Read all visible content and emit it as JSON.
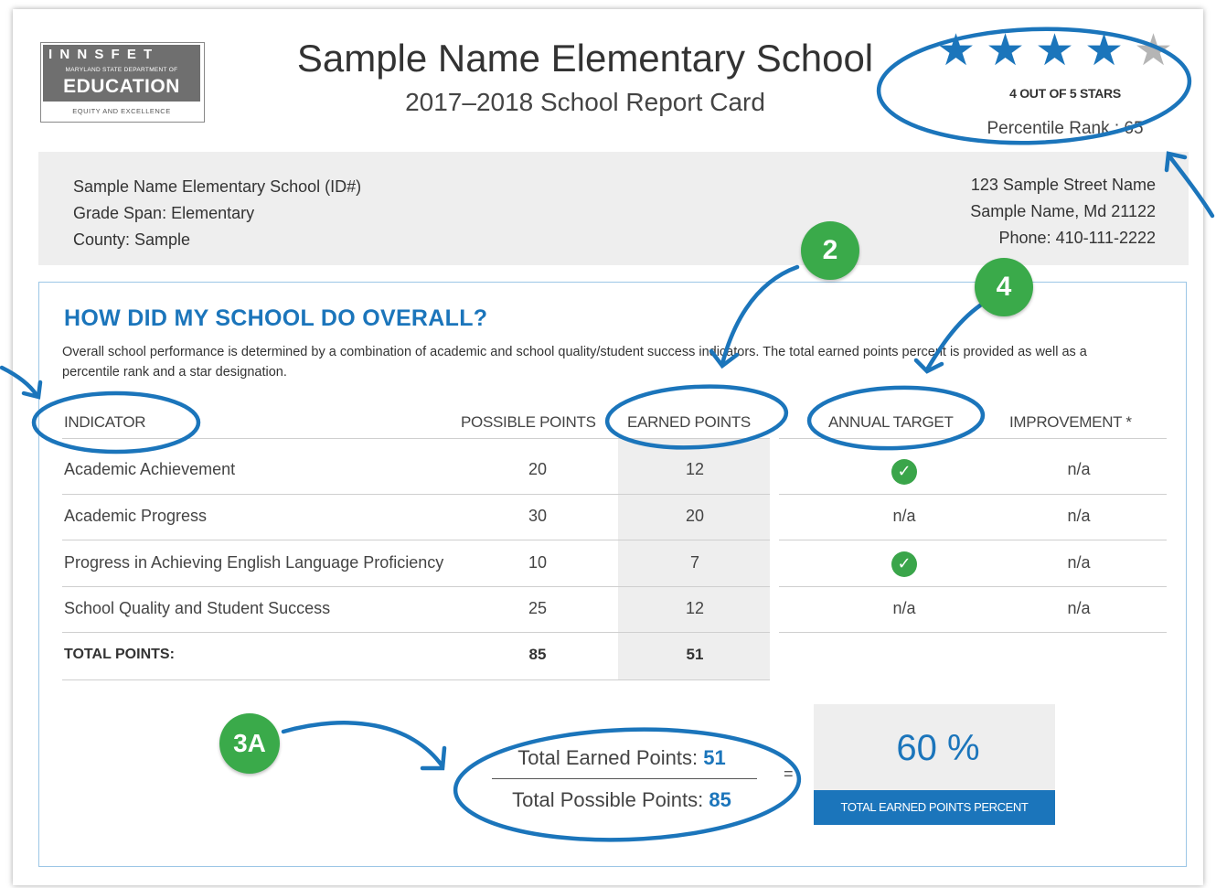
{
  "logo": {
    "stripe": "I N N S F E T",
    "dept": "MARYLAND STATE DEPARTMENT OF",
    "name": "EDUCATION",
    "motto": "EQUITY AND EXCELLENCE"
  },
  "header": {
    "title": "Sample Name Elementary School",
    "subtitle": "2017–2018 School Report Card"
  },
  "rating": {
    "stars_filled": 4,
    "stars_total": 5,
    "stars_text": "4 OUT OF 5 STARS",
    "percentile_label": "Percentile Rank : 65",
    "colors": {
      "star_filled": "#1b75bb",
      "star_empty": "#b5b5b5"
    }
  },
  "school_info": {
    "name": "Sample Name Elementary School (ID#)",
    "grade_span": "Grade Span: Elementary",
    "county": "County: Sample",
    "street": "123 Sample Street Name",
    "city": "Sample Name, Md  21122",
    "phone": "Phone: 410-111-2222"
  },
  "overall": {
    "heading": "HOW DID MY SCHOOL DO OVERALL?",
    "description": "Overall school performance is determined by a combination of academic and school quality/student success indicators. The total earned points percent is provided as well as a percentile rank and a star designation."
  },
  "table": {
    "headers": {
      "indicator": "INDICATOR",
      "possible": "POSSIBLE POINTS",
      "earned": "EARNED POINTS",
      "target": "ANNUAL TARGET",
      "improvement": "IMPROVEMENT *"
    },
    "rows": [
      {
        "indicator": "Academic Achievement",
        "possible": "20",
        "earned": "12",
        "target": "check",
        "improvement": "n/a"
      },
      {
        "indicator": "Academic Progress",
        "possible": "30",
        "earned": "20",
        "target": "n/a",
        "improvement": "n/a"
      },
      {
        "indicator": "Progress in Achieving English Language Proficiency",
        "possible": "10",
        "earned": "7",
        "target": "check",
        "improvement": "n/a"
      },
      {
        "indicator": "School Quality and Student Success",
        "possible": "25",
        "earned": "12",
        "target": "n/a",
        "improvement": "n/a"
      }
    ],
    "total": {
      "label": "TOTAL POINTS:",
      "possible": "85",
      "earned": "51"
    }
  },
  "summary": {
    "earned_label": "Total Earned Points: ",
    "earned_value": "51",
    "possible_label": "Total Possible Points: ",
    "possible_value": "85",
    "equals": "=",
    "percent": "60 %",
    "percent_label": "TOTAL EARNED POINTS PERCENT"
  },
  "callouts": {
    "badge_2": "2",
    "badge_4": "4",
    "badge_3a": "3A",
    "colors": {
      "badge": "#3aaa4a",
      "annotation": "#1b75bb"
    }
  }
}
